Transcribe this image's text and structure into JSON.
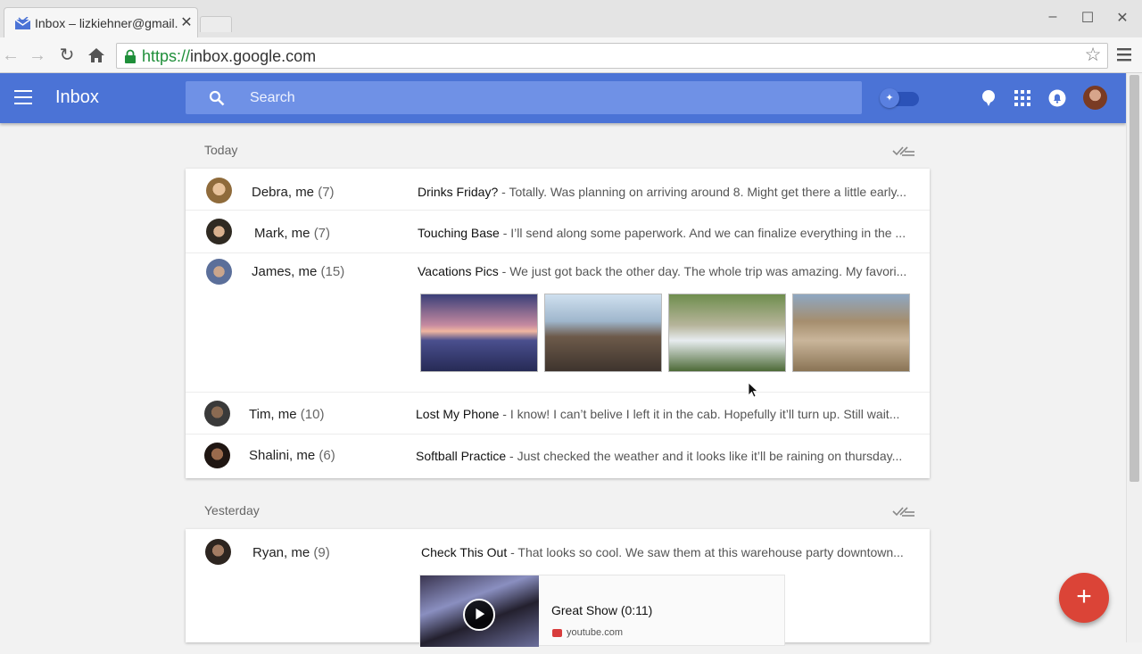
{
  "browser": {
    "tab_title": "Inbox – lizkiehner@gmail.com",
    "url_scheme": "https://",
    "url_host": "inbox.google.com",
    "window_controls": [
      "–",
      "☐",
      "✕"
    ]
  },
  "header": {
    "title": "Inbox",
    "search_placeholder": "Search"
  },
  "sections": [
    {
      "label": "Today",
      "threads": [
        {
          "sender": "Debra, me",
          "count": "(7)",
          "subject": "Drinks Friday?",
          "snippet": " - Totally. Was planning on arriving around 8. Might get there a little early..."
        },
        {
          "sender": "Mark, me",
          "count": "(7)",
          "subject": "Touching Base",
          "snippet": " - I’ll send along some paperwork. And we can finalize everything in the ..."
        },
        {
          "sender": "James, me",
          "count": "(15)",
          "subject": "Vacations Pics",
          "snippet": " - We just got back the other day. The whole trip was amazing. My favori..."
        },
        {
          "sender": "Tim, me",
          "count": "(10)",
          "subject": "Lost My Phone",
          "snippet": " - I know! I can’t belive I left it in the cab. Hopefully it’ll turn up. Still wait..."
        },
        {
          "sender": "Shalini, me",
          "count": "(6)",
          "subject": "Softball Practice",
          "snippet": " - Just checked the weather and it looks like it’ll be raining on thursday..."
        }
      ]
    },
    {
      "label": "Yesterday",
      "threads": [
        {
          "sender": "Ryan, me",
          "count": "(9)",
          "subject": "Check This Out",
          "snippet": " - That looks so cool. We saw them at this warehouse party downtown...",
          "video": {
            "title": "Great Show (0:11)",
            "source": "youtube.com"
          }
        }
      ]
    }
  ],
  "compose_label": "+",
  "colors": {
    "header": "#4b73d6",
    "search": "#6f91e6",
    "fab": "#db4437"
  }
}
